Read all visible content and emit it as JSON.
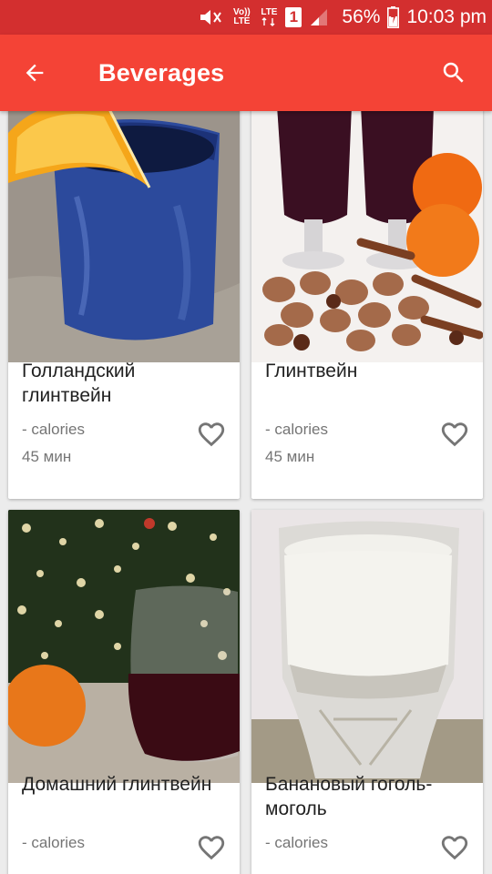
{
  "status_bar": {
    "volte": "Vo)) LTE",
    "lte": "LTE",
    "sim": "1",
    "battery": "56%",
    "time": "10:03 pm"
  },
  "app_bar": {
    "title": "Beverages",
    "back_icon": "arrow-back-icon",
    "search_icon": "search-icon"
  },
  "recipes": [
    {
      "name": "Голландский глинтвейн",
      "calories": "- calories",
      "time": "45 мин"
    },
    {
      "name": "Глинтвейн",
      "calories": "- calories",
      "time": "45 мин"
    },
    {
      "name": "Домашний глинтвейн",
      "calories": "- calories",
      "time": ""
    },
    {
      "name": "Банановый гоголь-моголь",
      "calories": "- calories",
      "time": ""
    }
  ],
  "colors": {
    "status_bar": "#d32f2f",
    "app_bar": "#f44336",
    "background": "#ececec"
  }
}
